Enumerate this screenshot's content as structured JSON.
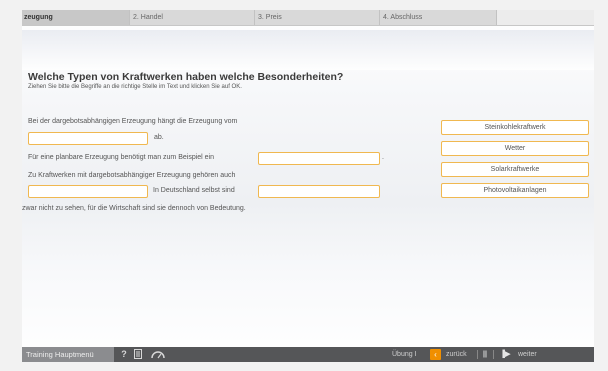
{
  "steps": [
    {
      "label": "zeugung"
    },
    {
      "label": "2. Handel"
    },
    {
      "label": "3. Preis"
    },
    {
      "label": "4. Abschluss"
    }
  ],
  "question": {
    "title": "Welche Typen von Kraftwerken haben welche Besonderheiten?",
    "instruction": "Ziehen Sie bitte die Begriffe an die richtige Stelle im Text und klicken Sie auf OK."
  },
  "text": {
    "line1": "Bei der dargebotsabhängigen Erzeugung hängt die Erzeugung vom",
    "line2_after": "ab.",
    "line3_before": "Für eine planbare Erzeugung benötigt man zum Beispiel ein",
    "line3_after": ".",
    "line4": "Zu Kraftwerken mit dargebotsabhängiger Erzeugung gehören auch",
    "line5_mid": "In Deutschland selbst sind",
    "line6": "zwar nicht zu sehen, für die Wirtschaft sind sie dennoch von Bedeutung."
  },
  "options": [
    {
      "label": "Steinkohlekraftwerk"
    },
    {
      "label": "Wetter"
    },
    {
      "label": "Solarkraftwerke"
    },
    {
      "label": "Photovoltaikanlagen"
    }
  ],
  "bottom": {
    "home_label": "Training Hauptmenü",
    "help_icon": "?",
    "mode_label": "Übung I",
    "back_label": "zurück",
    "next_label": "weiter"
  },
  "colors": {
    "accent": "#f08f00",
    "blank_border": "#f0b850"
  }
}
